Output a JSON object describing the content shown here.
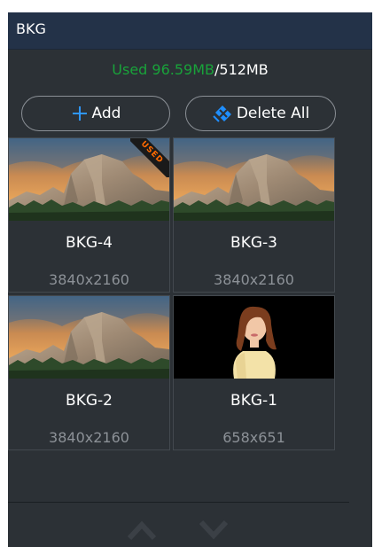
{
  "panel": {
    "title": "BKG"
  },
  "usage": {
    "used_text": "Used 96.59MB",
    "total_text": "/512MB"
  },
  "buttons": {
    "add_label": "Add",
    "add_icon": "plus-icon",
    "delete_all_label": "Delete All",
    "delete_all_icon": "delete-all-icon"
  },
  "backgrounds": [
    {
      "name": "BKG-4",
      "resolution": "3840x2160",
      "thumbnail": "mountain-cliff",
      "badge": "USED"
    },
    {
      "name": "BKG-3",
      "resolution": "3840x2160",
      "thumbnail": "mountain-cliff"
    },
    {
      "name": "BKG-2",
      "resolution": "3840x2160",
      "thumbnail": "mountain-cliff"
    },
    {
      "name": "BKG-1",
      "resolution": "658x651",
      "thumbnail": "portrait-woman"
    }
  ],
  "navigation": {
    "up_icon": "chevron-up-icon",
    "down_icon": "chevron-down-icon"
  },
  "colors": {
    "header": "#233248",
    "panel": "#2c3136",
    "used": "#19a23a",
    "accent_icon": "#1f8fff",
    "badge_text": "#ff6a00"
  }
}
